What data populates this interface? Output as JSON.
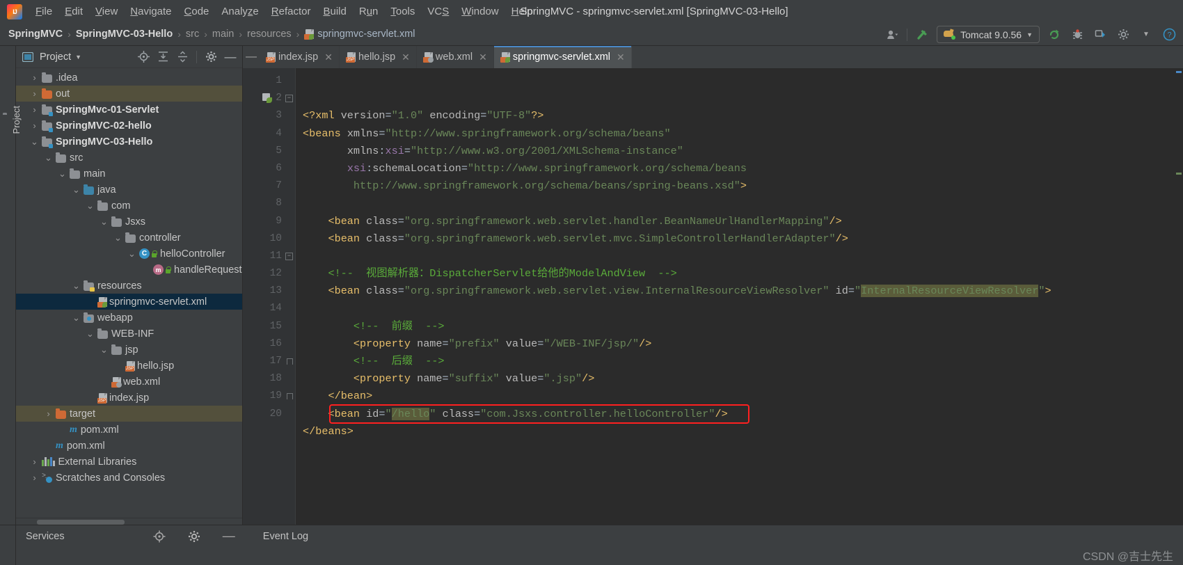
{
  "window": {
    "title": "SpringMVC - springmvc-servlet.xml [SpringMVC-03-Hello]",
    "logo": "intellij-idea-logo"
  },
  "menubar": {
    "items": [
      {
        "label": "File",
        "mnemonic": "F"
      },
      {
        "label": "Edit",
        "mnemonic": "E"
      },
      {
        "label": "View",
        "mnemonic": "V"
      },
      {
        "label": "Navigate",
        "mnemonic": "N"
      },
      {
        "label": "Code",
        "mnemonic": "C"
      },
      {
        "label": "Analyze",
        "mnemonic": "z"
      },
      {
        "label": "Refactor",
        "mnemonic": "R"
      },
      {
        "label": "Build",
        "mnemonic": "B"
      },
      {
        "label": "Run",
        "mnemonic": "u"
      },
      {
        "label": "Tools",
        "mnemonic": "T"
      },
      {
        "label": "VCS",
        "mnemonic": "S"
      },
      {
        "label": "Window",
        "mnemonic": "W"
      },
      {
        "label": "Help",
        "mnemonic": "H"
      }
    ]
  },
  "navbar": {
    "breadcrumbs": [
      {
        "label": "SpringMVC",
        "style": "bold"
      },
      {
        "label": "SpringMVC-03-Hello",
        "style": "bold"
      },
      {
        "label": "src",
        "style": "dim"
      },
      {
        "label": "main",
        "style": "dim"
      },
      {
        "label": "resources",
        "style": "dim"
      },
      {
        "label": "springmvc-servlet.xml",
        "style": "file"
      }
    ],
    "separator": "›",
    "run_config": "Tomcat 9.0.56",
    "icons": [
      "user-avatar-icon",
      "chevron-down-icon",
      "build-hammer-icon",
      "tomcat-icon",
      "run-restart-icon",
      "debug-icon",
      "updating-icon",
      "settings-icon",
      "chevron-down-icon",
      "help-icon"
    ]
  },
  "project_panel": {
    "title": "Project",
    "vertical_tab": "Project",
    "toolbar_icons": [
      "locate-target-icon",
      "expand-all-icon",
      "collapse-all-icon",
      "settings-gear-icon",
      "hide-minus-icon"
    ],
    "tree": [
      {
        "label": ".idea",
        "indent": 1,
        "arrow": "›",
        "icon": "folder",
        "bold": false,
        "state": "normal"
      },
      {
        "label": "out",
        "indent": 1,
        "arrow": "›",
        "icon": "folder-orange",
        "bold": false,
        "state": "excluded"
      },
      {
        "label": "SpringMvc-01-Servlet",
        "indent": 1,
        "arrow": "›",
        "icon": "folder-module",
        "bold": true,
        "state": "normal"
      },
      {
        "label": "SpringMVC-02-hello",
        "indent": 1,
        "arrow": "›",
        "icon": "folder-module",
        "bold": true,
        "state": "normal"
      },
      {
        "label": "SpringMVC-03-Hello",
        "indent": 1,
        "arrow": "⌄",
        "icon": "folder-module",
        "bold": true,
        "state": "normal"
      },
      {
        "label": "src",
        "indent": 2,
        "arrow": "⌄",
        "icon": "folder",
        "bold": false,
        "state": "normal"
      },
      {
        "label": "main",
        "indent": 3,
        "arrow": "⌄",
        "icon": "folder",
        "bold": false,
        "state": "normal"
      },
      {
        "label": "java",
        "indent": 4,
        "arrow": "⌄",
        "icon": "folder-source",
        "bold": false,
        "state": "normal"
      },
      {
        "label": "com",
        "indent": 5,
        "arrow": "⌄",
        "icon": "folder-package",
        "bold": false,
        "state": "normal"
      },
      {
        "label": "Jsxs",
        "indent": 6,
        "arrow": "⌄",
        "icon": "folder-package",
        "bold": false,
        "state": "normal"
      },
      {
        "label": "controller",
        "indent": 7,
        "arrow": "⌄",
        "icon": "folder-package",
        "bold": false,
        "state": "normal"
      },
      {
        "label": "helloController",
        "indent": 8,
        "arrow": "⌄",
        "icon": "java-class",
        "bold": false,
        "state": "normal"
      },
      {
        "label": "handleRequest",
        "indent": 9,
        "arrow": "",
        "icon": "java-method",
        "bold": false,
        "state": "normal"
      },
      {
        "label": "resources",
        "indent": 4,
        "arrow": "⌄",
        "icon": "folder-resource",
        "bold": false,
        "state": "normal"
      },
      {
        "label": "springmvc-servlet.xml",
        "indent": 5,
        "arrow": "",
        "icon": "xml-spring",
        "bold": false,
        "state": "selected"
      },
      {
        "label": "webapp",
        "indent": 4,
        "arrow": "⌄",
        "icon": "folder-web",
        "bold": false,
        "state": "normal"
      },
      {
        "label": "WEB-INF",
        "indent": 5,
        "arrow": "⌄",
        "icon": "folder",
        "bold": false,
        "state": "normal"
      },
      {
        "label": "jsp",
        "indent": 6,
        "arrow": "⌄",
        "icon": "folder",
        "bold": false,
        "state": "normal"
      },
      {
        "label": "hello.jsp",
        "indent": 7,
        "arrow": "",
        "icon": "jsp-file",
        "bold": false,
        "state": "normal"
      },
      {
        "label": "web.xml",
        "indent": 6,
        "arrow": "",
        "icon": "xml-web",
        "bold": false,
        "state": "normal"
      },
      {
        "label": "index.jsp",
        "indent": 5,
        "arrow": "",
        "icon": "jsp-file",
        "bold": false,
        "state": "normal"
      },
      {
        "label": "target",
        "indent": 2,
        "arrow": "›",
        "icon": "folder-orange",
        "bold": false,
        "state": "excluded"
      },
      {
        "label": "pom.xml",
        "indent": 3,
        "arrow": "",
        "icon": "maven-file",
        "bold": false,
        "state": "normal"
      },
      {
        "label": "pom.xml",
        "indent": 2,
        "arrow": "",
        "icon": "maven-file",
        "bold": false,
        "state": "normal"
      },
      {
        "label": "External Libraries",
        "indent": 1,
        "arrow": "›",
        "icon": "libraries",
        "bold": false,
        "state": "normal"
      },
      {
        "label": "Scratches and Consoles",
        "indent": 1,
        "arrow": "›",
        "icon": "scratches",
        "bold": false,
        "state": "normal"
      }
    ]
  },
  "editor": {
    "tabs": [
      {
        "label": "index.jsp",
        "icon": "jsp-file",
        "active": false,
        "closable": true
      },
      {
        "label": "hello.jsp",
        "icon": "jsp-file",
        "active": false,
        "closable": true
      },
      {
        "label": "web.xml",
        "icon": "xml-web",
        "active": false,
        "closable": true
      },
      {
        "label": "springmvc-servlet.xml",
        "icon": "xml-spring",
        "active": true,
        "closable": true
      }
    ],
    "line_numbers": [
      "1",
      "2",
      "3",
      "4",
      "5",
      "6",
      "7",
      "8",
      "9",
      "10",
      "11",
      "12",
      "13",
      "14",
      "15",
      "16",
      "17",
      "18",
      "19",
      "20"
    ],
    "lines": [
      {
        "n": 1,
        "parts": [
          {
            "t": "<?xml ",
            "c": "tagn"
          },
          {
            "t": "version",
            "c": "attr"
          },
          {
            "t": "=",
            "c": "punct"
          },
          {
            "t": "\"1.0\"",
            "c": "str"
          },
          {
            "t": " ",
            "c": "punct"
          },
          {
            "t": "encoding",
            "c": "attr"
          },
          {
            "t": "=",
            "c": "punct"
          },
          {
            "t": "\"UTF-8\"",
            "c": "str"
          },
          {
            "t": "?>",
            "c": "tagn"
          }
        ]
      },
      {
        "n": 2,
        "parts": [
          {
            "t": "<beans",
            "c": "tagn"
          },
          {
            "t": " ",
            "c": "punct"
          },
          {
            "t": "xmlns",
            "c": "attr"
          },
          {
            "t": "=",
            "c": "punct"
          },
          {
            "t": "\"http://www.springframework.org/schema/beans\"",
            "c": "str"
          }
        ]
      },
      {
        "n": 3,
        "parts": [
          {
            "t": "       ",
            "c": "punct"
          },
          {
            "t": "xmlns",
            "c": "attr"
          },
          {
            "t": ":",
            "c": "punct"
          },
          {
            "t": "xsi",
            "c": "attr-ns"
          },
          {
            "t": "=",
            "c": "punct"
          },
          {
            "t": "\"http://www.w3.org/2001/XMLSchema-instance\"",
            "c": "str"
          }
        ]
      },
      {
        "n": 4,
        "parts": [
          {
            "t": "       ",
            "c": "punct"
          },
          {
            "t": "xsi",
            "c": "attr-ns"
          },
          {
            "t": ":",
            "c": "punct"
          },
          {
            "t": "schemaLocation",
            "c": "attr"
          },
          {
            "t": "=",
            "c": "punct"
          },
          {
            "t": "\"http://www.springframework.org/schema/beans",
            "c": "str"
          }
        ]
      },
      {
        "n": 5,
        "parts": [
          {
            "t": "        http://www.springframework.org/schema/beans/spring-beans.xsd\"",
            "c": "str"
          },
          {
            "t": ">",
            "c": "tagn"
          }
        ]
      },
      {
        "n": 6,
        "parts": []
      },
      {
        "n": 7,
        "parts": [
          {
            "t": "    ",
            "c": "punct"
          },
          {
            "t": "<bean",
            "c": "tagn"
          },
          {
            "t": " ",
            "c": "punct"
          },
          {
            "t": "class",
            "c": "attr"
          },
          {
            "t": "=",
            "c": "punct"
          },
          {
            "t": "\"org.springframework.web.servlet.handler.BeanNameUrlHandlerMapping\"",
            "c": "str"
          },
          {
            "t": "/>",
            "c": "tagn"
          }
        ]
      },
      {
        "n": 8,
        "parts": [
          {
            "t": "    ",
            "c": "punct"
          },
          {
            "t": "<bean",
            "c": "tagn"
          },
          {
            "t": " ",
            "c": "punct"
          },
          {
            "t": "class",
            "c": "attr"
          },
          {
            "t": "=",
            "c": "punct"
          },
          {
            "t": "\"org.springframework.web.servlet.mvc.SimpleControllerHandlerAdapter\"",
            "c": "str"
          },
          {
            "t": "/>",
            "c": "tagn"
          }
        ]
      },
      {
        "n": 9,
        "parts": []
      },
      {
        "n": 10,
        "parts": [
          {
            "t": "    <!--  视图解析器：DispatcherServlet给他的ModelAndView  -->",
            "c": "cmt"
          }
        ]
      },
      {
        "n": 11,
        "parts": [
          {
            "t": "    ",
            "c": "punct"
          },
          {
            "t": "<bean",
            "c": "tagn"
          },
          {
            "t": " ",
            "c": "punct"
          },
          {
            "t": "class",
            "c": "attr"
          },
          {
            "t": "=",
            "c": "punct"
          },
          {
            "t": "\"org.springframework.web.servlet.view.InternalResourceViewResolver\"",
            "c": "str"
          },
          {
            "t": " ",
            "c": "punct"
          },
          {
            "t": "id",
            "c": "attr"
          },
          {
            "t": "=",
            "c": "punct"
          },
          {
            "t": "\"",
            "c": "str"
          },
          {
            "t": "InternalResourceViewResolver",
            "c": "str hl-id"
          },
          {
            "t": "\"",
            "c": "str"
          },
          {
            "t": ">",
            "c": "tagn"
          }
        ]
      },
      {
        "n": 12,
        "parts": []
      },
      {
        "n": 13,
        "parts": [
          {
            "t": "        <!--  前缀  -->",
            "c": "cmt"
          }
        ]
      },
      {
        "n": 14,
        "parts": [
          {
            "t": "        ",
            "c": "punct"
          },
          {
            "t": "<property",
            "c": "tagn"
          },
          {
            "t": " ",
            "c": "punct"
          },
          {
            "t": "name",
            "c": "attr"
          },
          {
            "t": "=",
            "c": "punct"
          },
          {
            "t": "\"prefix\"",
            "c": "str"
          },
          {
            "t": " ",
            "c": "punct"
          },
          {
            "t": "value",
            "c": "attr"
          },
          {
            "t": "=",
            "c": "punct"
          },
          {
            "t": "\"/WEB-INF/jsp/\"",
            "c": "str"
          },
          {
            "t": "/>",
            "c": "tagn"
          }
        ]
      },
      {
        "n": 15,
        "parts": [
          {
            "t": "        <!--  后缀  -->",
            "c": "cmt"
          }
        ]
      },
      {
        "n": 16,
        "parts": [
          {
            "t": "        ",
            "c": "punct"
          },
          {
            "t": "<property",
            "c": "tagn"
          },
          {
            "t": " ",
            "c": "punct"
          },
          {
            "t": "name",
            "c": "attr"
          },
          {
            "t": "=",
            "c": "punct"
          },
          {
            "t": "\"suffix\"",
            "c": "str"
          },
          {
            "t": " ",
            "c": "punct"
          },
          {
            "t": "value",
            "c": "attr"
          },
          {
            "t": "=",
            "c": "punct"
          },
          {
            "t": "\".jsp\"",
            "c": "str"
          },
          {
            "t": "/>",
            "c": "tagn"
          }
        ]
      },
      {
        "n": 17,
        "parts": [
          {
            "t": "    ",
            "c": "punct"
          },
          {
            "t": "</bean>",
            "c": "tagn"
          }
        ]
      },
      {
        "n": 18,
        "parts": [
          {
            "t": "    ",
            "c": "punct"
          },
          {
            "t": "<bean",
            "c": "tagn"
          },
          {
            "t": " ",
            "c": "punct"
          },
          {
            "t": "id",
            "c": "attr"
          },
          {
            "t": "=",
            "c": "punct"
          },
          {
            "t": "\"",
            "c": "str"
          },
          {
            "t": "/hello",
            "c": "str hl-id"
          },
          {
            "t": "\"",
            "c": "str"
          },
          {
            "t": " ",
            "c": "punct"
          },
          {
            "t": "class",
            "c": "attr"
          },
          {
            "t": "=",
            "c": "punct"
          },
          {
            "t": "\"com.Jsxs.controller.helloController\"",
            "c": "str"
          },
          {
            "t": "/>",
            "c": "tagn"
          }
        ]
      },
      {
        "n": 19,
        "parts": [
          {
            "t": "</beans>",
            "c": "tagn"
          }
        ]
      },
      {
        "n": 20,
        "parts": []
      }
    ],
    "annotation": {
      "type": "red-rectangle",
      "around_line": 18
    }
  },
  "bottom": {
    "services_label": "Services",
    "event_log_label": "Event Log",
    "icons": [
      "locate-target-icon",
      "settings-gear-icon",
      "hide-minus-icon"
    ]
  },
  "watermark": "CSDN @吉士先生",
  "colors": {
    "background": "#3c3f41",
    "editor_bg": "#2b2b2b",
    "gutter_bg": "#313335",
    "selection": "#0d293e",
    "excluded": "#53503c",
    "tag": "#e8bf6a",
    "string": "#6a8759",
    "comment": "#5aab3a",
    "attr_ns": "#9876aa",
    "accent": "#4a88c7",
    "annotation_red": "#ff2020",
    "tab_active": "#4e5254"
  }
}
